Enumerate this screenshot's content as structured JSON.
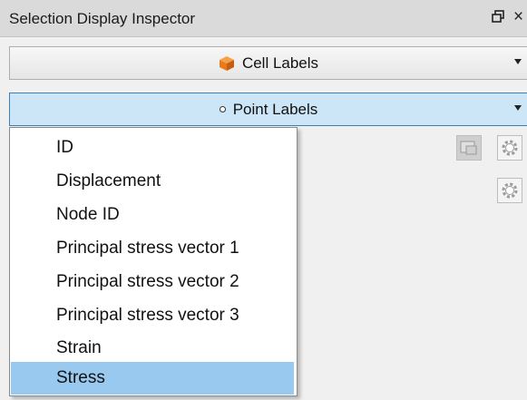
{
  "panel": {
    "title": "Selection Display Inspector",
    "float_icon_glyph": "Ǿ",
    "close_glyph": "×"
  },
  "cell_labels": {
    "label": "Cell Labels",
    "icon": "cube-icon"
  },
  "point_labels": {
    "label": "Point Labels",
    "icon": "point-icon",
    "options": [
      "ID",
      "Displacement",
      "Node ID",
      "Principal stress vector 1",
      "Principal stress vector 2",
      "Principal stress vector 3",
      "Strain",
      "Stress"
    ],
    "highlighted": "Stress"
  },
  "colors": {
    "accent": "#cde6f7",
    "accent_border": "#3c7fb1",
    "selection": "#99c9ef",
    "cube": "#e87a1e"
  }
}
